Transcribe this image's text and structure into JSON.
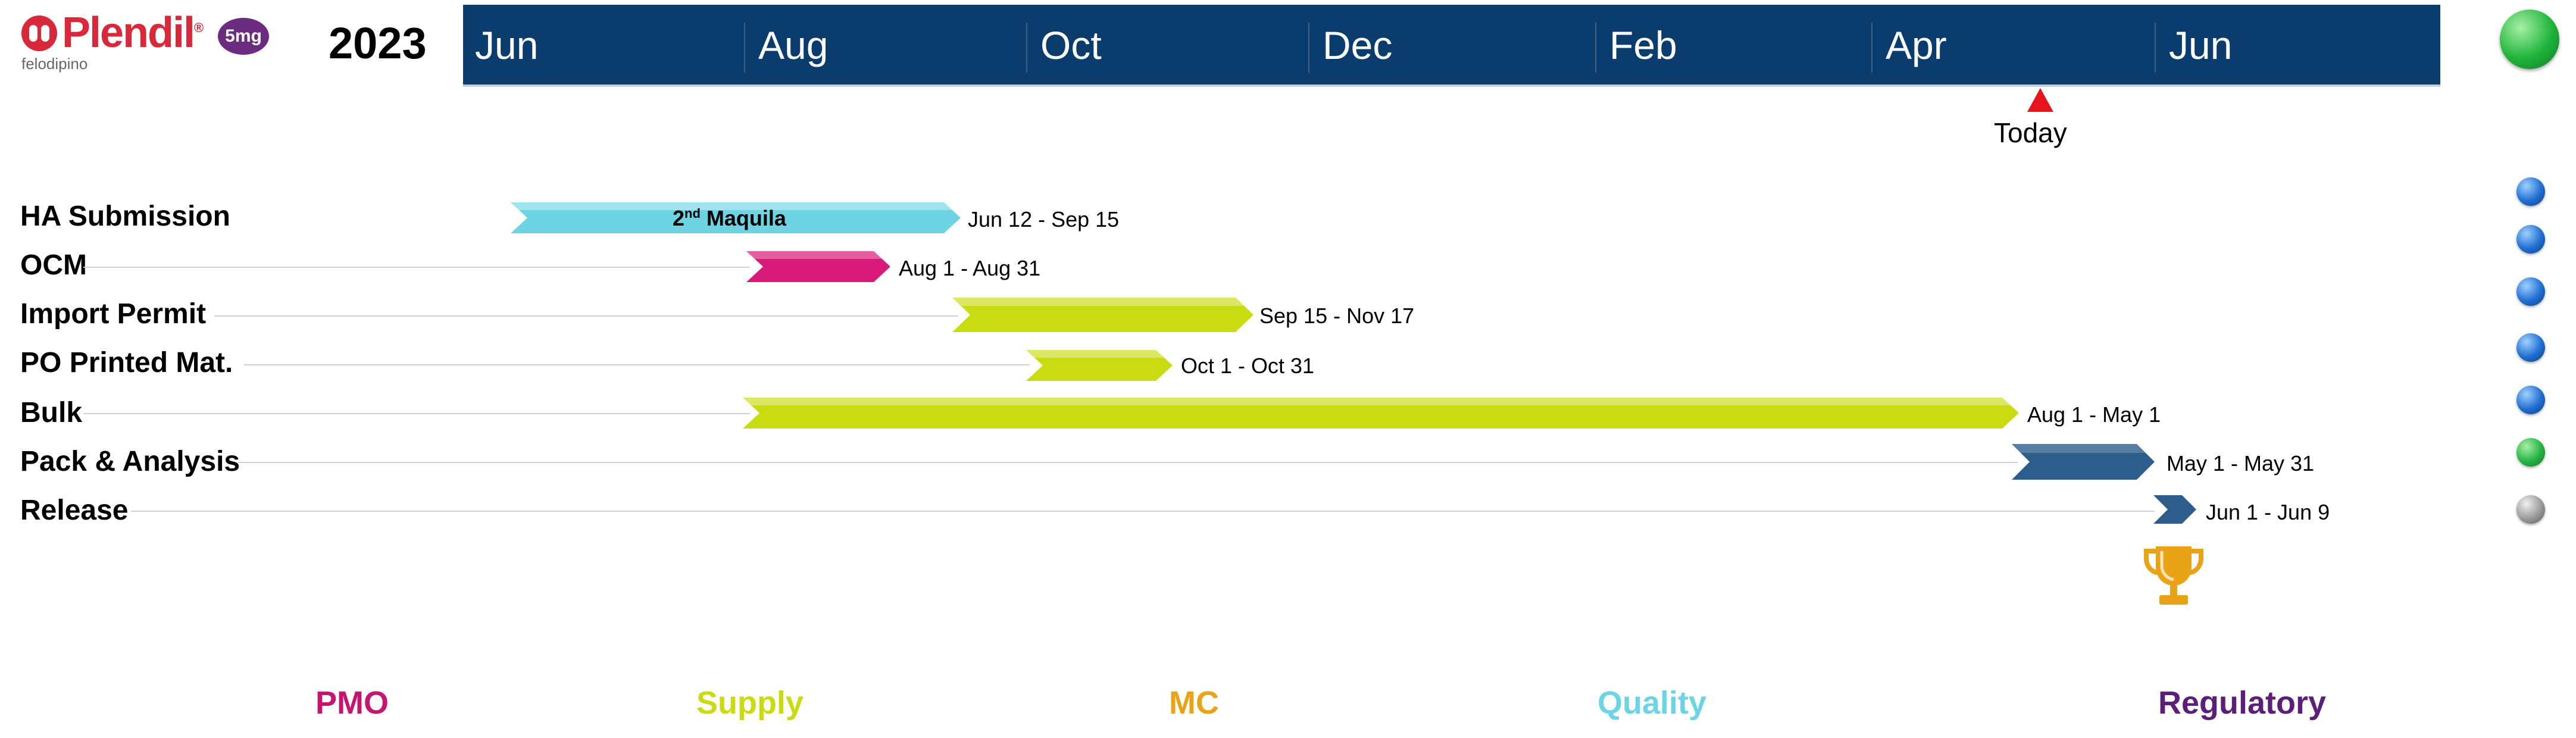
{
  "logo": {
    "brand": "Plendil",
    "reg": "®",
    "generic": "felodipino",
    "dose": "5mg"
  },
  "year": "2023",
  "header": {
    "months": [
      "Jun",
      "Aug",
      "Oct",
      "Dec",
      "Feb",
      "Apr",
      "Jun"
    ],
    "color": "#0a3c6e"
  },
  "today": {
    "label": "Today",
    "color": "#e8161c"
  },
  "tasks": [
    {
      "label": "HA Submission",
      "dates": "Jun 12 - Sep 15",
      "bar_text": "2",
      "bar_text_sup": "nd",
      "bar_text_rest": " Maquila",
      "color": "#6dd4e3",
      "status": "blue"
    },
    {
      "label": "OCM",
      "dates": "Aug 1 - Aug 31",
      "color": "#d81b7a",
      "status": "blue"
    },
    {
      "label": "Import Permit",
      "dates": "Sep 15 - Nov 17",
      "color": "#c9dc12",
      "status": "blue"
    },
    {
      "label": "PO Printed Mat.",
      "dates": "Oct 1 - Oct 31",
      "color": "#c9dc12",
      "status": "blue"
    },
    {
      "label": "Bulk",
      "dates": "Aug 1 - May 1",
      "color": "#c9dc12",
      "status": "blue"
    },
    {
      "label": "Pack & Analysis",
      "dates": "May 1 - May 31",
      "color": "#2d5d8a",
      "status": "green"
    },
    {
      "label": "Release",
      "dates": "Jun 1 - Jun 9",
      "color": "#2d5d8a",
      "status": "grey"
    }
  ],
  "overall_status": "green",
  "milestone": {
    "icon": "trophy-icon",
    "color": "#e8a317"
  },
  "categories": [
    {
      "label": "PMO",
      "color": "#c4156f"
    },
    {
      "label": "Supply",
      "color": "#c9dc12"
    },
    {
      "label": "MC",
      "color": "#e8a317"
    },
    {
      "label": "Quality",
      "color": "#6dd4e3"
    },
    {
      "label": "Regulatory",
      "color": "#5b1f7a"
    }
  ]
}
